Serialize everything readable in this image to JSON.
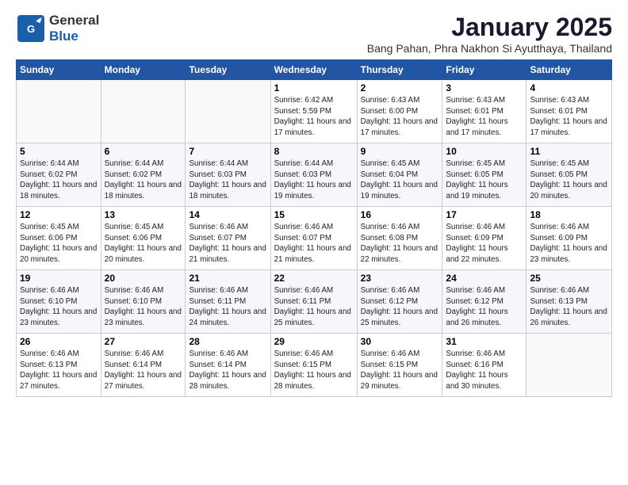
{
  "header": {
    "logo_general": "General",
    "logo_blue": "Blue",
    "month_title": "January 2025",
    "location": "Bang Pahan, Phra Nakhon Si Ayutthaya, Thailand"
  },
  "days_of_week": [
    "Sunday",
    "Monday",
    "Tuesday",
    "Wednesday",
    "Thursday",
    "Friday",
    "Saturday"
  ],
  "weeks": [
    [
      {
        "day": "",
        "info": ""
      },
      {
        "day": "",
        "info": ""
      },
      {
        "day": "",
        "info": ""
      },
      {
        "day": "1",
        "info": "Sunrise: 6:42 AM\nSunset: 5:59 PM\nDaylight: 11 hours and 17 minutes."
      },
      {
        "day": "2",
        "info": "Sunrise: 6:43 AM\nSunset: 6:00 PM\nDaylight: 11 hours and 17 minutes."
      },
      {
        "day": "3",
        "info": "Sunrise: 6:43 AM\nSunset: 6:01 PM\nDaylight: 11 hours and 17 minutes."
      },
      {
        "day": "4",
        "info": "Sunrise: 6:43 AM\nSunset: 6:01 PM\nDaylight: 11 hours and 17 minutes."
      }
    ],
    [
      {
        "day": "5",
        "info": "Sunrise: 6:44 AM\nSunset: 6:02 PM\nDaylight: 11 hours and 18 minutes."
      },
      {
        "day": "6",
        "info": "Sunrise: 6:44 AM\nSunset: 6:02 PM\nDaylight: 11 hours and 18 minutes."
      },
      {
        "day": "7",
        "info": "Sunrise: 6:44 AM\nSunset: 6:03 PM\nDaylight: 11 hours and 18 minutes."
      },
      {
        "day": "8",
        "info": "Sunrise: 6:44 AM\nSunset: 6:03 PM\nDaylight: 11 hours and 19 minutes."
      },
      {
        "day": "9",
        "info": "Sunrise: 6:45 AM\nSunset: 6:04 PM\nDaylight: 11 hours and 19 minutes."
      },
      {
        "day": "10",
        "info": "Sunrise: 6:45 AM\nSunset: 6:05 PM\nDaylight: 11 hours and 19 minutes."
      },
      {
        "day": "11",
        "info": "Sunrise: 6:45 AM\nSunset: 6:05 PM\nDaylight: 11 hours and 20 minutes."
      }
    ],
    [
      {
        "day": "12",
        "info": "Sunrise: 6:45 AM\nSunset: 6:06 PM\nDaylight: 11 hours and 20 minutes."
      },
      {
        "day": "13",
        "info": "Sunrise: 6:45 AM\nSunset: 6:06 PM\nDaylight: 11 hours and 20 minutes."
      },
      {
        "day": "14",
        "info": "Sunrise: 6:46 AM\nSunset: 6:07 PM\nDaylight: 11 hours and 21 minutes."
      },
      {
        "day": "15",
        "info": "Sunrise: 6:46 AM\nSunset: 6:07 PM\nDaylight: 11 hours and 21 minutes."
      },
      {
        "day": "16",
        "info": "Sunrise: 6:46 AM\nSunset: 6:08 PM\nDaylight: 11 hours and 22 minutes."
      },
      {
        "day": "17",
        "info": "Sunrise: 6:46 AM\nSunset: 6:09 PM\nDaylight: 11 hours and 22 minutes."
      },
      {
        "day": "18",
        "info": "Sunrise: 6:46 AM\nSunset: 6:09 PM\nDaylight: 11 hours and 23 minutes."
      }
    ],
    [
      {
        "day": "19",
        "info": "Sunrise: 6:46 AM\nSunset: 6:10 PM\nDaylight: 11 hours and 23 minutes."
      },
      {
        "day": "20",
        "info": "Sunrise: 6:46 AM\nSunset: 6:10 PM\nDaylight: 11 hours and 23 minutes."
      },
      {
        "day": "21",
        "info": "Sunrise: 6:46 AM\nSunset: 6:11 PM\nDaylight: 11 hours and 24 minutes."
      },
      {
        "day": "22",
        "info": "Sunrise: 6:46 AM\nSunset: 6:11 PM\nDaylight: 11 hours and 25 minutes."
      },
      {
        "day": "23",
        "info": "Sunrise: 6:46 AM\nSunset: 6:12 PM\nDaylight: 11 hours and 25 minutes."
      },
      {
        "day": "24",
        "info": "Sunrise: 6:46 AM\nSunset: 6:12 PM\nDaylight: 11 hours and 26 minutes."
      },
      {
        "day": "25",
        "info": "Sunrise: 6:46 AM\nSunset: 6:13 PM\nDaylight: 11 hours and 26 minutes."
      }
    ],
    [
      {
        "day": "26",
        "info": "Sunrise: 6:46 AM\nSunset: 6:13 PM\nDaylight: 11 hours and 27 minutes."
      },
      {
        "day": "27",
        "info": "Sunrise: 6:46 AM\nSunset: 6:14 PM\nDaylight: 11 hours and 27 minutes."
      },
      {
        "day": "28",
        "info": "Sunrise: 6:46 AM\nSunset: 6:14 PM\nDaylight: 11 hours and 28 minutes."
      },
      {
        "day": "29",
        "info": "Sunrise: 6:46 AM\nSunset: 6:15 PM\nDaylight: 11 hours and 28 minutes."
      },
      {
        "day": "30",
        "info": "Sunrise: 6:46 AM\nSunset: 6:15 PM\nDaylight: 11 hours and 29 minutes."
      },
      {
        "day": "31",
        "info": "Sunrise: 6:46 AM\nSunset: 6:16 PM\nDaylight: 11 hours and 30 minutes."
      },
      {
        "day": "",
        "info": ""
      }
    ]
  ]
}
